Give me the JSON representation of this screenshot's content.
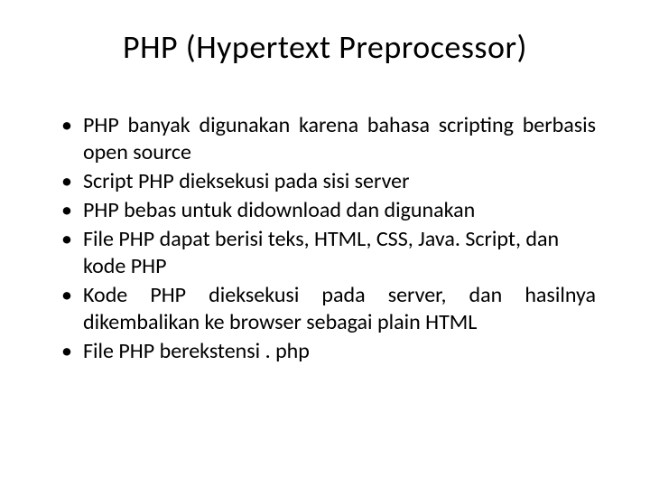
{
  "title": "PHP (Hypertext Preprocessor)",
  "bullets": [
    "PHP banyak digunakan karena bahasa scripting berbasis open source",
    "Script PHP dieksekusi pada sisi server",
    "PHP bebas untuk didownload dan digunakan",
    "File PHP dapat berisi teks, HTML, CSS, Java. Script, dan kode PHP",
    "Kode PHP dieksekusi pada server, dan hasilnya dikembalikan ke browser sebagai plain HTML",
    "File PHP berekstensi . php"
  ]
}
